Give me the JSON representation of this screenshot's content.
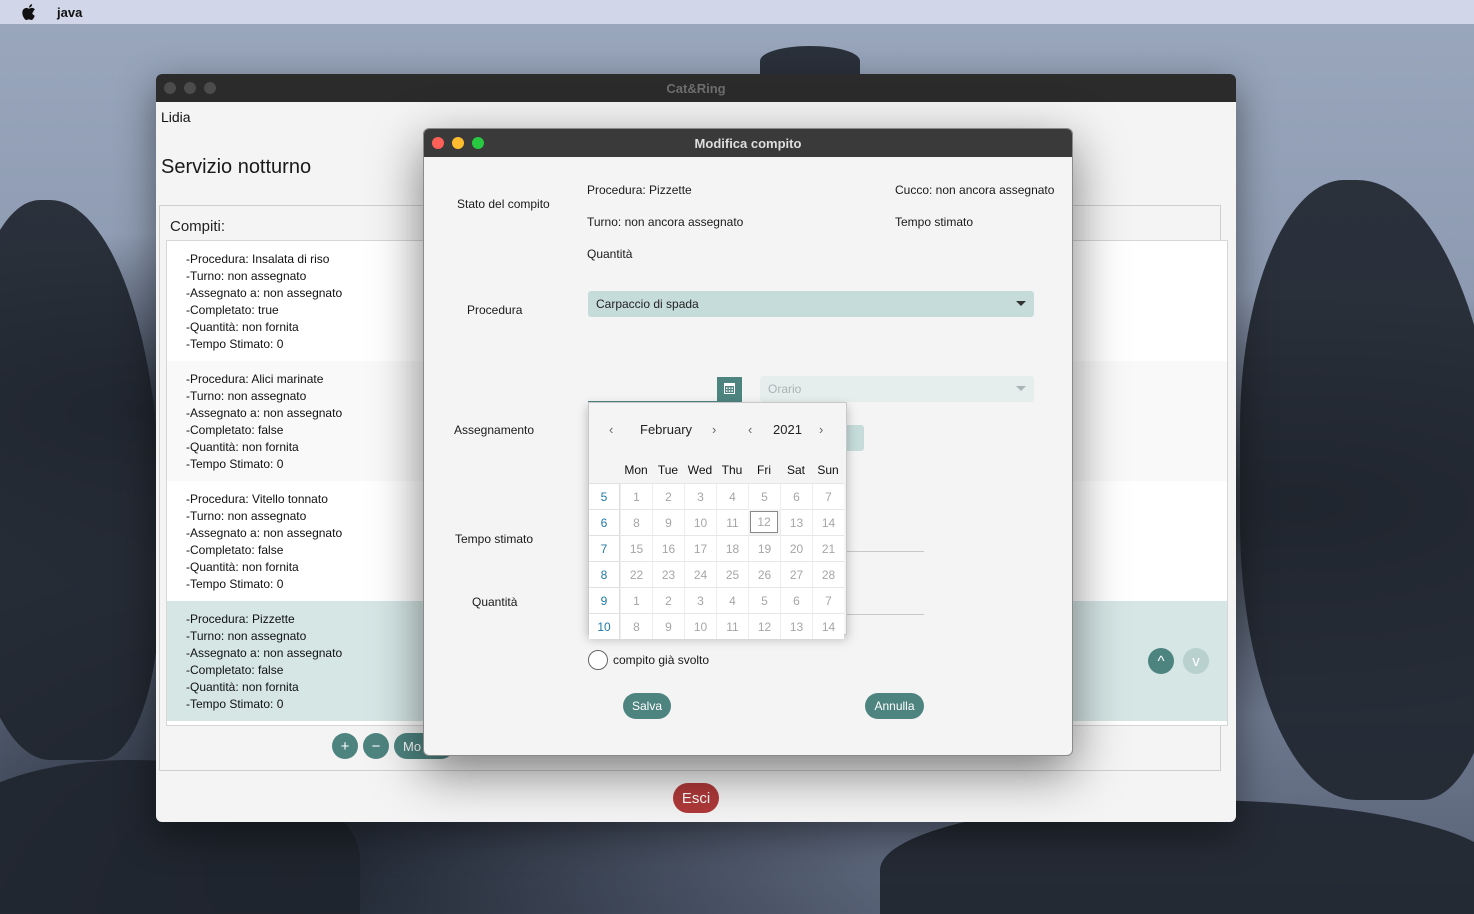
{
  "menubar": {
    "app_name": "java"
  },
  "main_window": {
    "title": "Cat&Ring",
    "user": "Lidia",
    "service_title": "Servizio notturno",
    "tasks_label": "Compiti:",
    "tasks": [
      {
        "lines": [
          "-Procedura: Insalata di riso",
          "-Turno: non assegnato",
          "-Assegnato a: non assegnato",
          "-Completato: true",
          "-Quantità: non fornita",
          "-Tempo Stimato: 0"
        ]
      },
      {
        "lines": [
          "-Procedura: Alici marinate",
          "-Turno: non assegnato",
          "-Assegnato a: non assegnato",
          "-Completato: false",
          "-Quantità: non fornita",
          "-Tempo Stimato: 0"
        ]
      },
      {
        "lines": [
          "-Procedura: Vitello tonnato",
          "-Turno: non assegnato",
          "-Assegnato a: non assegnato",
          "-Completato: false",
          "-Quantità: non fornita",
          "-Tempo Stimato: 0"
        ]
      },
      {
        "lines": [
          "-Procedura: Pizzette",
          "-Turno: non assegnato",
          "-Assegnato a: non assegnato",
          "-Completato: false",
          "-Quantità: non fornita",
          "-Tempo Stimato: 0"
        ]
      }
    ],
    "add_label": "+",
    "remove_label": "−",
    "modify_label": "Mo",
    "up_label": "^",
    "down_label": "v",
    "exit_label": "Esci"
  },
  "dialog": {
    "title": "Modifica compito",
    "state_label": "Stato del compito",
    "info_procedure": "Procedura: Pizzette",
    "info_cook": "Cucco: non ancora assegnato",
    "info_shift": "Turno: non ancora assegnato",
    "info_time": "Tempo stimato",
    "info_quantity": "Quantità",
    "procedure_label": "Procedura",
    "procedure_value": "Carpaccio di spada",
    "assignment_label": "Assegnamento",
    "time_placeholder": "Orario",
    "estimated_time_label": "Tempo stimato",
    "quantity_label": "Quantità",
    "done_label": "compito già svolto",
    "save_label": "Salva",
    "cancel_label": "Annulla"
  },
  "calendar": {
    "month": "February",
    "year": "2021",
    "prev_icon": "‹",
    "next_icon": "›",
    "weekdays": [
      "Mon",
      "Tue",
      "Wed",
      "Thu",
      "Fri",
      "Sat",
      "Sun"
    ],
    "weeks": [
      {
        "week": "5",
        "days": [
          "1",
          "2",
          "3",
          "4",
          "5",
          "6",
          "7"
        ]
      },
      {
        "week": "6",
        "days": [
          "8",
          "9",
          "10",
          "11",
          "12",
          "13",
          "14"
        ]
      },
      {
        "week": "7",
        "days": [
          "15",
          "16",
          "17",
          "18",
          "19",
          "20",
          "21"
        ]
      },
      {
        "week": "8",
        "days": [
          "22",
          "23",
          "24",
          "25",
          "26",
          "27",
          "28"
        ]
      },
      {
        "week": "9",
        "days": [
          "1",
          "2",
          "3",
          "4",
          "5",
          "6",
          "7"
        ]
      },
      {
        "week": "10",
        "days": [
          "8",
          "9",
          "10",
          "11",
          "12",
          "13",
          "14"
        ]
      }
    ],
    "today": "12"
  },
  "colors": {
    "accent": "#4e8480",
    "exit": "#b0393a",
    "selected_row": "#d5e6e5"
  }
}
